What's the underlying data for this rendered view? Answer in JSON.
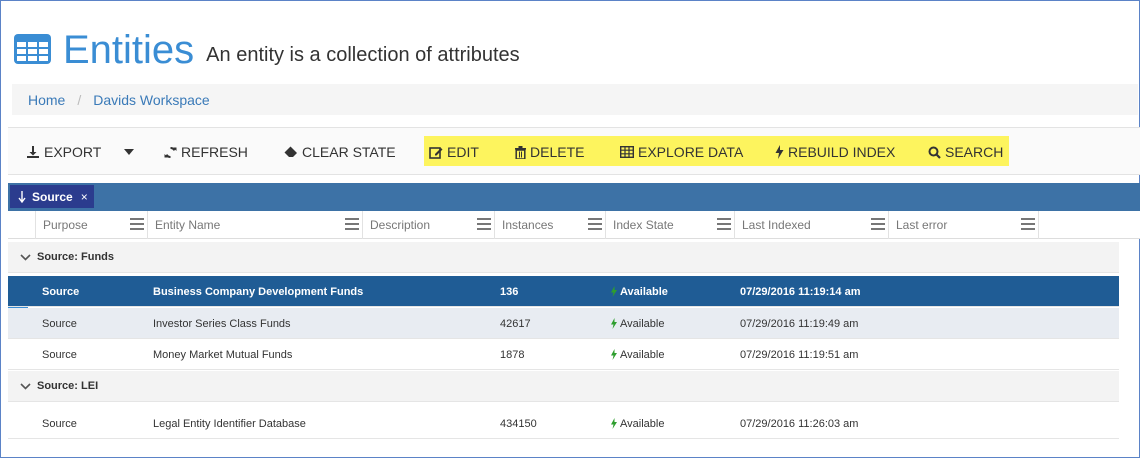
{
  "page": {
    "title": "Entities",
    "subtitle": "An entity is a collection of attributes"
  },
  "breadcrumb": [
    "Home",
    "Davids Workspace"
  ],
  "toolbar": {
    "export": "EXPORT",
    "refresh": "REFRESH",
    "clear_state": "CLEAR STATE",
    "edit": "EDIT",
    "delete": "DELETE",
    "explore_data": "EXPLORE DATA",
    "rebuild_index": "REBUILD INDEX",
    "search": "SEARCH",
    "highlight_color": "#fdf45e"
  },
  "grouping": {
    "chip_label": "Source",
    "chip_close": "×"
  },
  "columns": [
    "Purpose",
    "Entity Name",
    "Description",
    "Instances",
    "Index State",
    "Last Indexed",
    "Last error"
  ],
  "groups": [
    {
      "label": "Source: Funds",
      "rows": [
        {
          "purpose": "Source",
          "name": "Business Company Development Funds",
          "instances": "136",
          "state": "Available",
          "last_indexed": "07/29/2016 11:19:14 am"
        },
        {
          "purpose": "Source",
          "name": "Investor Series Class Funds",
          "instances": "42617",
          "state": "Available",
          "last_indexed": "07/29/2016 11:19:49 am"
        },
        {
          "purpose": "Source",
          "name": "Money Market Mutual Funds",
          "instances": "1878",
          "state": "Available",
          "last_indexed": "07/29/2016 11:19:51 am"
        }
      ]
    },
    {
      "label": "Source: LEI",
      "rows": [
        {
          "purpose": "Source",
          "name": "Legal Entity Identifier Database",
          "instances": "434150",
          "state": "Available",
          "last_indexed": "07/29/2016 11:26:03 am"
        }
      ]
    }
  ],
  "colors": {
    "accent": "#3a8dd4",
    "selected_row": "#1f5c95",
    "group_bar": "#3d72a6",
    "chip": "#2b3c8e",
    "available": "#2e9e2e"
  }
}
